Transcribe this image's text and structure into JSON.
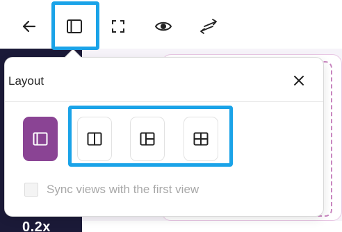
{
  "toolbar": {
    "icons": [
      "arrow-left-icon",
      "layout-panel-icon",
      "fullscreen-icon",
      "eye-icon",
      "swap-arrows-icon"
    ]
  },
  "background": {
    "partial_label": "0.2x"
  },
  "popover": {
    "title": "Layout",
    "close_icon": "close-icon",
    "options": [
      {
        "name": "single-view",
        "icon": "single-panel-icon",
        "active": true
      },
      {
        "name": "two-column",
        "icon": "two-column-icon",
        "active": false
      },
      {
        "name": "three-panel",
        "icon": "three-panel-icon",
        "active": false
      },
      {
        "name": "four-grid",
        "icon": "four-grid-icon",
        "active": false
      }
    ],
    "sync_label": "Sync views with the first view",
    "sync_checked": false
  },
  "colors": {
    "accent": "#8a4494",
    "highlight": "#1aa3e8",
    "dark_panel": "#1b1a38"
  }
}
